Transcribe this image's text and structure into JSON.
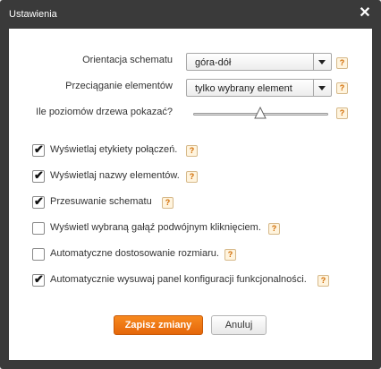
{
  "dialog": {
    "title": "Ustawienia"
  },
  "settings": {
    "orientation": {
      "label": "Orientacja schematu",
      "value": "góra-dół"
    },
    "dragging": {
      "label": "Przeciąganie elementów",
      "value": "tylko wybrany element"
    },
    "tree_levels": {
      "label": "Ile poziomów drzewa pokazać?",
      "position_fraction": 0.5
    }
  },
  "help_glyph": "?",
  "checkbox_mark": "✔",
  "checkboxes": [
    {
      "label": "Wyświetlaj etykiety połączeń.",
      "checked": true
    },
    {
      "label": "Wyświetlaj nazwy elementów.",
      "checked": true
    },
    {
      "label": "Przesuwanie schematu",
      "checked": true
    },
    {
      "label": "Wyświetl wybraną gałąź podwójnym kliknięciem.",
      "checked": false
    },
    {
      "label": "Automatyczne dostosowanie rozmiaru.",
      "checked": false
    },
    {
      "label": "Automatycznie wysuwaj panel konfiguracji funkcjonalności.",
      "checked": true
    }
  ],
  "buttons": {
    "save": "Zapisz zmiany",
    "cancel": "Anuluj"
  },
  "colors": {
    "accent": "#f07a14",
    "dialog_frame": "#3a3a3a"
  }
}
